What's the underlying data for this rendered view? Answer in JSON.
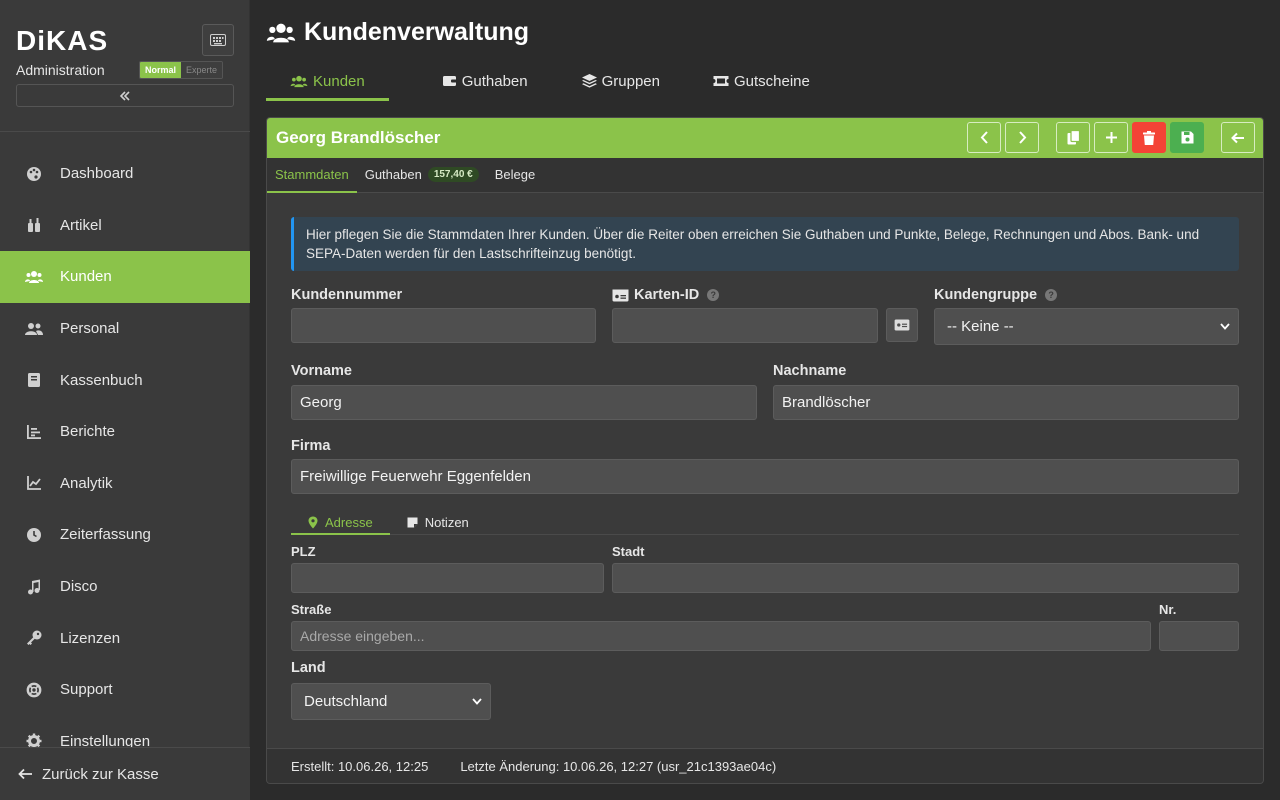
{
  "app": {
    "logo": "DiKAS",
    "section_label": "Administration",
    "mode_normal": "Normal",
    "mode_expert": "Experte",
    "accent": "#8bc34a"
  },
  "sidebar": {
    "items": [
      {
        "label": "Dashboard",
        "icon": "palette-icon"
      },
      {
        "label": "Artikel",
        "icon": "bottles-icon"
      },
      {
        "label": "Kunden",
        "icon": "users-icon",
        "active": true
      },
      {
        "label": "Personal",
        "icon": "user-group-icon"
      },
      {
        "label": "Kassenbuch",
        "icon": "book-icon"
      },
      {
        "label": "Berichte",
        "icon": "bar-chart-icon"
      },
      {
        "label": "Analytik",
        "icon": "line-chart-icon"
      },
      {
        "label": "Zeiterfassung",
        "icon": "clock-icon"
      },
      {
        "label": "Disco",
        "icon": "music-icon"
      },
      {
        "label": "Lizenzen",
        "icon": "key-icon"
      },
      {
        "label": "Support",
        "icon": "lifebuoy-icon"
      },
      {
        "label": "Einstellungen",
        "icon": "gear-icon"
      }
    ],
    "back_label": "Zurück zur Kasse"
  },
  "page": {
    "title": "Kundenverwaltung",
    "tabs": [
      {
        "label": "Kunden",
        "active": true
      },
      {
        "label": "Guthaben"
      },
      {
        "label": "Gruppen"
      },
      {
        "label": "Gutscheine"
      }
    ]
  },
  "customer": {
    "name": "Georg Brandlöscher",
    "subtabs": {
      "stammdaten": "Stammdaten",
      "guthaben": "Guthaben",
      "guthaben_badge": "157,40 €",
      "belege": "Belege"
    },
    "info_text": "Hier pflegen Sie die Stammdaten Ihrer Kunden. Über die Reiter oben erreichen Sie Guthaben und Punkte, Belege, Rechnungen und Abos. Bank- und SEPA-Daten werden für den Lastschrifteinzug benötigt.",
    "labels": {
      "kundennummer": "Kundennummer",
      "karten_id": "Karten-ID",
      "kundengruppe": "Kundengruppe",
      "vorname": "Vorname",
      "nachname": "Nachname",
      "firma": "Firma",
      "plz": "PLZ",
      "stadt": "Stadt",
      "strasse": "Straße",
      "nr": "Nr.",
      "land": "Land"
    },
    "values": {
      "kundennummer": "",
      "karten_id": "",
      "kundengruppe": "-- Keine --",
      "vorname": "Georg",
      "nachname": "Brandlöscher",
      "firma": "Freiwillige Feuerwehr Eggenfelden",
      "plz": "",
      "stadt": "",
      "strasse_placeholder": "Adresse eingeben...",
      "nr": "",
      "land": "Deutschland"
    },
    "address_tabs": {
      "adresse": "Adresse",
      "notizen": "Notizen"
    },
    "footer": {
      "created": "Erstellt: 10.06.26, 12:25",
      "modified": "Letzte Änderung: 10.06.26, 12:27 (usr_21c1393ae04c)"
    }
  }
}
